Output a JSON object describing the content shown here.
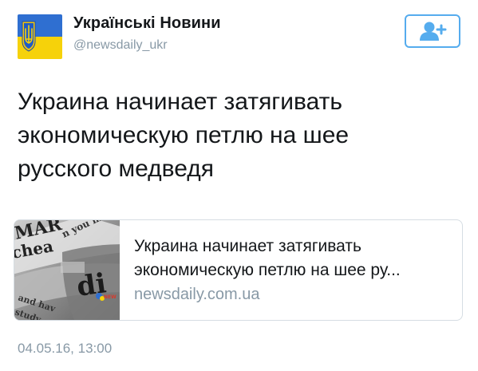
{
  "author": {
    "display_name": "Українські Новини",
    "handle": "@newsdaily_ukr",
    "avatar_icon": "ukraine-trident-flag-icon"
  },
  "follow_button": {
    "icon": "person-add-icon",
    "color": "#55acee"
  },
  "tweet": {
    "text_lines": [
      "Украина начинает затягивать",
      "экономическую петлю на шее",
      "русского медведя"
    ]
  },
  "link_card": {
    "thumbnail_icon": "newspaper-thumbnail-image",
    "title_lines": [
      "Украина начинает затягивать",
      "экономическую петлю на шее ру..."
    ],
    "domain": "newsdaily.com.ua"
  },
  "timestamp": "04.05.16, 13:00",
  "colors": {
    "text": "#14171a",
    "secondary": "#8899a6",
    "accent": "#55acee",
    "border": "#d6dde3",
    "flag_blue": "#2f6fd1",
    "flag_yellow": "#f6d20a"
  }
}
